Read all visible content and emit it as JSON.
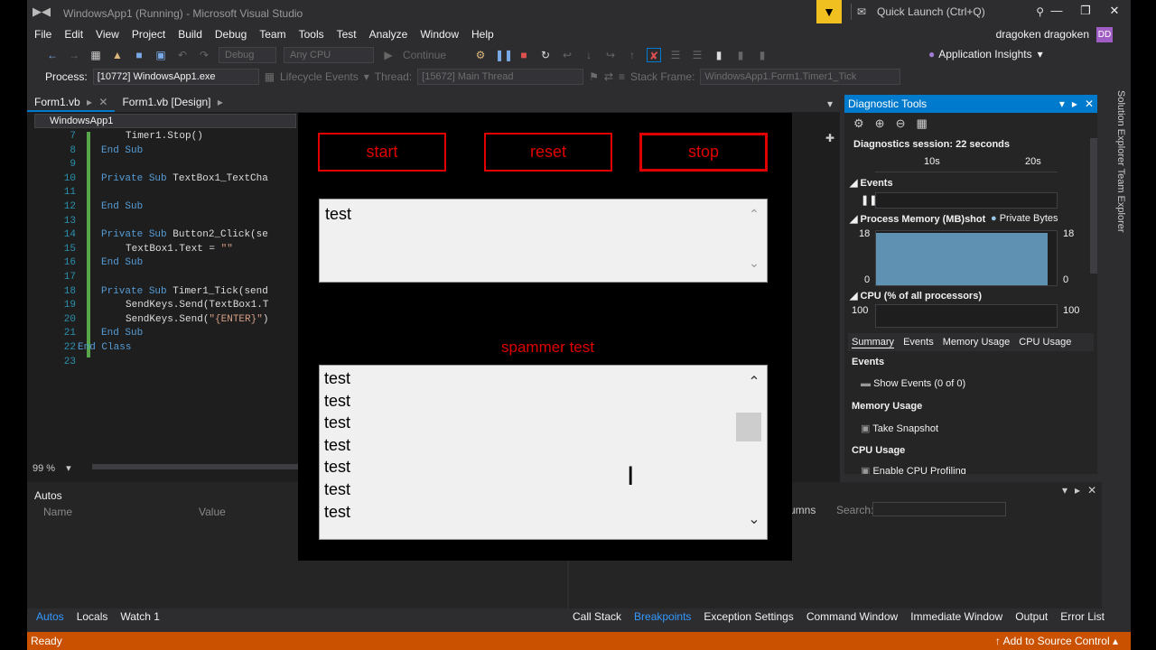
{
  "titlebar": {
    "title": "WindowsApp1 (Running) - Microsoft Visual Studio",
    "quick_launch": "Quick Launch (Ctrl+Q)"
  },
  "menu": [
    "File",
    "Edit",
    "View",
    "Project",
    "Build",
    "Debug",
    "Team",
    "Tools",
    "Test",
    "Analyze",
    "Window",
    "Help"
  ],
  "user": {
    "name": "dragoken dragoken",
    "initials": "DD"
  },
  "toolbar": {
    "config": "Debug",
    "platform": "Any CPU",
    "continue": "Continue",
    "app_insights": "Application Insights"
  },
  "process_bar": {
    "process_label": "Process:",
    "process_value": "[10772] WindowsApp1.exe",
    "lifecycle": "Lifecycle Events",
    "thread_label": "Thread:",
    "thread_value": "[15672] Main Thread",
    "stack_label": "Stack Frame:",
    "stack_value": "WindowsApp1.Form1.Timer1_Tick"
  },
  "tabs": [
    "Form1.vb",
    "Form1.vb [Design]"
  ],
  "editor": {
    "nav": "WindowsApp1",
    "zoom": "99 %",
    "lines": [
      {
        "n": "7",
        "indent": "    ",
        "code": "Timer1.Stop()"
      },
      {
        "n": "8",
        "indent": "",
        "code": "End Sub"
      },
      {
        "n": "9",
        "indent": "",
        "code": ""
      },
      {
        "n": "10",
        "indent": "",
        "code": "Private Sub TextBox1_TextCha"
      },
      {
        "n": "11",
        "indent": "",
        "code": ""
      },
      {
        "n": "12",
        "indent": "",
        "code": "End Sub"
      },
      {
        "n": "13",
        "indent": "",
        "code": ""
      },
      {
        "n": "14",
        "indent": "",
        "code": "Private Sub Button2_Click(se"
      },
      {
        "n": "15",
        "indent": "    ",
        "code": "TextBox1.Text = \"\""
      },
      {
        "n": "16",
        "indent": "",
        "code": "End Sub"
      },
      {
        "n": "17",
        "indent": "",
        "code": ""
      },
      {
        "n": "18",
        "indent": "",
        "code": "Private Sub Timer1_Tick(send"
      },
      {
        "n": "19",
        "indent": "    ",
        "code": "SendKeys.Send(TextBox1.T"
      },
      {
        "n": "20",
        "indent": "    ",
        "code": "SendKeys.Send(\"{ENTER}\")"
      },
      {
        "n": "21",
        "indent": "",
        "code": "End Sub"
      },
      {
        "n": "22",
        "indent": "",
        "code": "End Class"
      },
      {
        "n": "23",
        "indent": "",
        "code": ""
      }
    ]
  },
  "autos": {
    "title": "Autos",
    "col_name": "Name",
    "col_value": "Value",
    "tabs": [
      "Autos",
      "Locals",
      "Watch 1"
    ],
    "search": "Search:",
    "columns": "umns"
  },
  "bottom_right_tabs": [
    "Call Stack",
    "Breakpoints",
    "Exception Settings",
    "Command Window",
    "Immediate Window",
    "Output",
    "Error List"
  ],
  "diag": {
    "title": "Diagnostic Tools",
    "session": "Diagnostics session: 22 seconds",
    "t1": "10s",
    "t2": "20s",
    "events": "Events",
    "memory": "Process Memory (MB)",
    "snapshot": "shot",
    "private_bytes": "Private Bytes",
    "mem_max": "18",
    "mem_min": "0",
    "cpu": "CPU (% of all processors)",
    "cpu_max": "100",
    "tabs": [
      "Summary",
      "Events",
      "Memory Usage",
      "CPU Usage"
    ],
    "sec_events": "Events",
    "show_events": "Show Events (0 of 0)",
    "sec_mem": "Memory Usage",
    "take_snapshot": "Take Snapshot",
    "sec_cpu": "CPU Usage",
    "enable_cpu": "Enable CPU Profiling"
  },
  "side_tabs": "Solution Explorer   Team Explorer",
  "status": {
    "left": "Ready",
    "right": "Add to Source Control"
  },
  "form": {
    "start": "start",
    "reset": "reset",
    "stop": "stop",
    "input_text": "test",
    "label": "spammer test",
    "output_lines": [
      "test",
      "test",
      "test",
      "test",
      "test",
      "test",
      "test"
    ]
  }
}
